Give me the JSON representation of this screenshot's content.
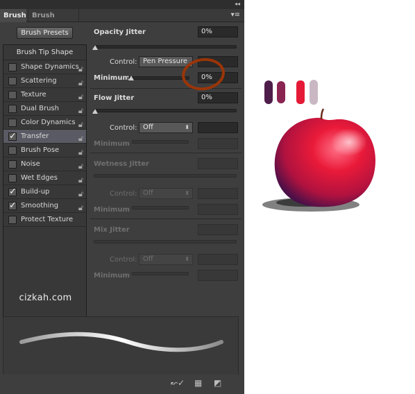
{
  "tabs": [
    {
      "label": "Brush",
      "active": true
    },
    {
      "label": "Brush Presets",
      "active": false
    }
  ],
  "presets_button": "Brush Presets",
  "tip_header": "Brush Tip Shape",
  "tip_items": [
    {
      "label": "Shape Dynamics",
      "checked": false
    },
    {
      "label": "Scattering",
      "checked": false
    },
    {
      "label": "Texture",
      "checked": false
    },
    {
      "label": "Dual Brush",
      "checked": false
    },
    {
      "label": "Color Dynamics",
      "checked": false
    },
    {
      "label": "Transfer",
      "checked": true,
      "selected": true
    },
    {
      "label": "Brush Pose",
      "checked": false
    },
    {
      "label": "Noise",
      "checked": false
    },
    {
      "label": "Wet Edges",
      "checked": false
    },
    {
      "label": "Build-up",
      "checked": true
    },
    {
      "label": "Smoothing",
      "checked": true
    },
    {
      "label": "Protect Texture",
      "checked": false
    }
  ],
  "watermark": "cizkah.com",
  "settings": {
    "opacity_jitter": {
      "label": "Opacity Jitter",
      "value": "0%"
    },
    "control1": {
      "label": "Control:",
      "value": "Pen Pressure"
    },
    "minimum1": {
      "label": "Minimum",
      "value": "0%"
    },
    "flow_jitter": {
      "label": "Flow Jitter",
      "value": "0%"
    },
    "control2": {
      "label": "Control:",
      "value": "Off"
    },
    "minimum2": {
      "label": "Minimum"
    },
    "wetness_jitter": {
      "label": "Wetness Jitter"
    },
    "control3": {
      "label": "Control:",
      "value": "Off"
    },
    "minimum3": {
      "label": "Minimum"
    },
    "mix_jitter": {
      "label": "Mix Jitter"
    },
    "control4": {
      "label": "Control:",
      "value": "Off"
    },
    "minimum4": {
      "label": "Minimum"
    }
  },
  "colors": {
    "swatch1": "#4e1d4a",
    "swatch2": "#8a2451",
    "swatch3": "#e51a36",
    "swatch4": "#c9b8c4",
    "annotation_circle": "#9a3508",
    "apple_red": "#e31836"
  }
}
